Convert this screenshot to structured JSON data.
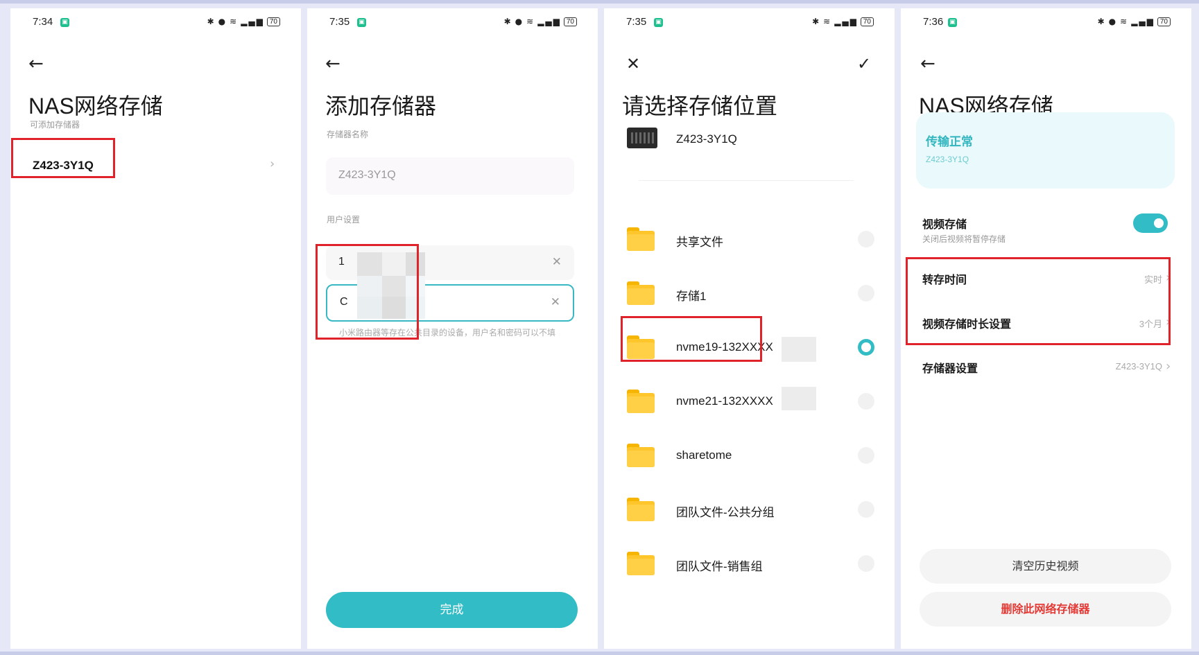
{
  "status": {
    "screen1_time": "7:34",
    "screen2_time": "7:35",
    "screen3_time": "7:35",
    "screen4_time": "7:36",
    "battery": "70"
  },
  "screen1": {
    "title": "NAS网络存储",
    "section_label": "可添加存储器",
    "device": "Z423-3Y1Q"
  },
  "screen2": {
    "title": "添加存储器",
    "name_label": "存储器名称",
    "name_value": "Z423-3Y1Q",
    "user_label": "用户设置",
    "username_value": "1",
    "password_value": "C",
    "hint": "小米路由器等存在公共目录的设备，用户名和密码可以不填",
    "done_label": "完成"
  },
  "screen3": {
    "title": "请选择存储位置",
    "device": "Z423-3Y1Q",
    "folders": [
      {
        "name": "共享文件",
        "selected": false
      },
      {
        "name": "存储1",
        "selected": false
      },
      {
        "name": "nvme19-132XXXX",
        "selected": true
      },
      {
        "name": "nvme21-132XXXX",
        "selected": false
      },
      {
        "name": "sharetome",
        "selected": false
      },
      {
        "name": "团队文件-公共分组",
        "selected": false
      },
      {
        "name": "团队文件-销售组",
        "selected": false
      }
    ]
  },
  "screen4": {
    "title": "NAS网络存储",
    "status_heading": "传输正常",
    "status_device": "Z423-3Y1Q",
    "video_storage_label": "视频存储",
    "video_storage_sub": "关闭后视频将暂停存储",
    "video_storage_on": true,
    "transfer_time_label": "转存时间",
    "transfer_time_value": "实时",
    "duration_label": "视频存储时长设置",
    "duration_value": "3个月",
    "storage_settings_label": "存储器设置",
    "storage_settings_value": "Z423-3Y1Q",
    "clear_label": "清空历史视频",
    "delete_label": "删除此网络存储器"
  },
  "colors": {
    "accent": "#32bcc5",
    "highlight": "#e0222a",
    "danger": "#e43a36",
    "folder": "#ffc62b"
  }
}
